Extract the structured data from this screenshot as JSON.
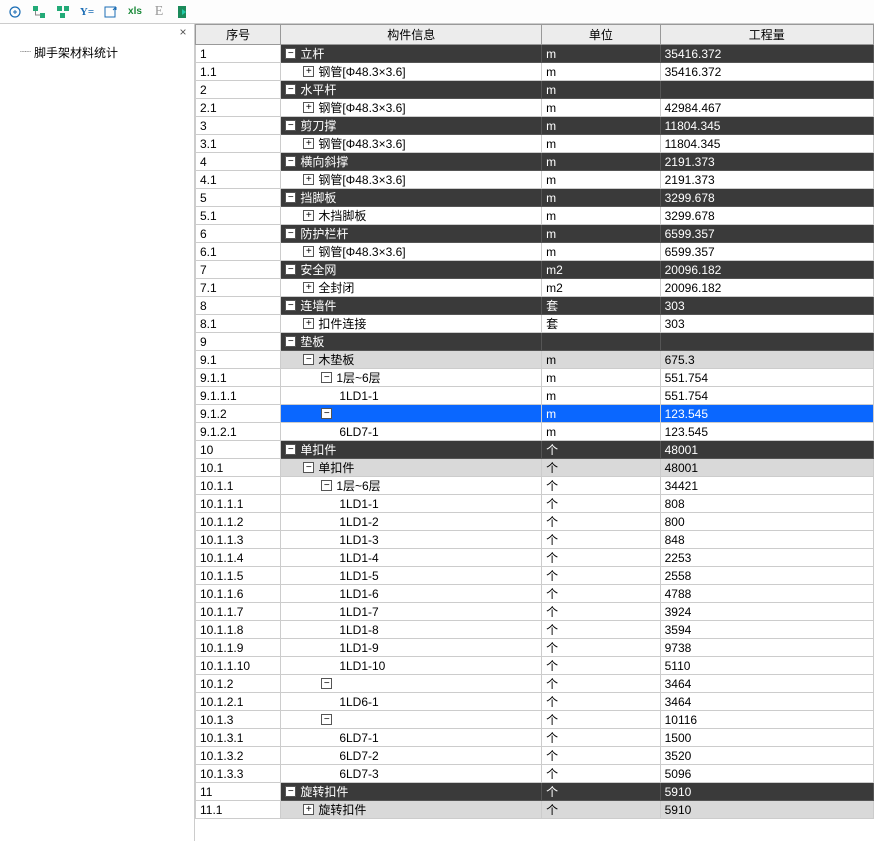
{
  "toolbar": {
    "icons": [
      "link",
      "node1",
      "node2",
      "formula",
      "export",
      "xls",
      "E",
      "exit"
    ]
  },
  "tree": {
    "close": "×",
    "root": "脚手架材料统计"
  },
  "columns": {
    "seq": "序号",
    "info": "构件信息",
    "unit": "单位",
    "qty": "工程量"
  },
  "rows": [
    {
      "seq": "1",
      "info": "立杆",
      "unit": "m",
      "qty": "35416.372",
      "indent": 0,
      "toggle": "-",
      "style": "dark"
    },
    {
      "seq": "1.1",
      "info": "钢管[Φ48.3×3.6]",
      "unit": "m",
      "qty": "35416.372",
      "indent": 1,
      "toggle": "+",
      "style": ""
    },
    {
      "seq": "2",
      "info": "水平杆",
      "unit": "m",
      "qty": "",
      "indent": 0,
      "toggle": "-",
      "style": "dark"
    },
    {
      "seq": "2.1",
      "info": "钢管[Φ48.3×3.6]",
      "unit": "m",
      "qty": "42984.467",
      "indent": 1,
      "toggle": "+",
      "style": ""
    },
    {
      "seq": "3",
      "info": "剪刀撑",
      "unit": "m",
      "qty": "11804.345",
      "indent": 0,
      "toggle": "-",
      "style": "dark"
    },
    {
      "seq": "3.1",
      "info": "钢管[Φ48.3×3.6]",
      "unit": "m",
      "qty": "11804.345",
      "indent": 1,
      "toggle": "+",
      "style": ""
    },
    {
      "seq": "4",
      "info": "横向斜撑",
      "unit": "m",
      "qty": "2191.373",
      "indent": 0,
      "toggle": "-",
      "style": "dark"
    },
    {
      "seq": "4.1",
      "info": "钢管[Φ48.3×3.6]",
      "unit": "m",
      "qty": "2191.373",
      "indent": 1,
      "toggle": "+",
      "style": ""
    },
    {
      "seq": "5",
      "info": "挡脚板",
      "unit": "m",
      "qty": "3299.678",
      "indent": 0,
      "toggle": "-",
      "style": "dark"
    },
    {
      "seq": "5.1",
      "info": "木挡脚板",
      "unit": "m",
      "qty": "3299.678",
      "indent": 1,
      "toggle": "+",
      "style": ""
    },
    {
      "seq": "6",
      "info": "防护栏杆",
      "unit": "m",
      "qty": "6599.357",
      "indent": 0,
      "toggle": "-",
      "style": "dark"
    },
    {
      "seq": "6.1",
      "info": "钢管[Φ48.3×3.6]",
      "unit": "m",
      "qty": "6599.357",
      "indent": 1,
      "toggle": "+",
      "style": ""
    },
    {
      "seq": "7",
      "info": "安全网",
      "unit": "m2",
      "qty": "20096.182",
      "indent": 0,
      "toggle": "-",
      "style": "dark"
    },
    {
      "seq": "7.1",
      "info": "全封闭",
      "unit": "m2",
      "qty": "20096.182",
      "indent": 1,
      "toggle": "+",
      "style": ""
    },
    {
      "seq": "8",
      "info": "连墙件",
      "unit": "套",
      "qty": "303",
      "indent": 0,
      "toggle": "-",
      "style": "dark"
    },
    {
      "seq": "8.1",
      "info": "扣件连接",
      "unit": "套",
      "qty": "303",
      "indent": 1,
      "toggle": "+",
      "style": ""
    },
    {
      "seq": "9",
      "info": "垫板",
      "unit": "",
      "qty": "",
      "indent": 0,
      "toggle": "-",
      "style": "dark"
    },
    {
      "seq": "9.1",
      "info": "木垫板",
      "unit": "m",
      "qty": "675.3",
      "indent": 1,
      "toggle": "-",
      "style": "gray"
    },
    {
      "seq": "9.1.1",
      "info": "1层~6层",
      "unit": "m",
      "qty": "551.754",
      "indent": 2,
      "toggle": "-",
      "style": ""
    },
    {
      "seq": "9.1.1.1",
      "info": "1LD1-1",
      "unit": "m",
      "qty": "551.754",
      "indent": 3,
      "toggle": "",
      "style": ""
    },
    {
      "seq": "9.1.2",
      "info": "",
      "unit": "m",
      "qty": "123.545",
      "indent": 2,
      "toggle": "-",
      "style": "sel"
    },
    {
      "seq": "9.1.2.1",
      "info": "6LD7-1",
      "unit": "m",
      "qty": "123.545",
      "indent": 3,
      "toggle": "",
      "style": ""
    },
    {
      "seq": "10",
      "info": "单扣件",
      "unit": "个",
      "qty": "48001",
      "indent": 0,
      "toggle": "-",
      "style": "dark"
    },
    {
      "seq": "10.1",
      "info": "单扣件",
      "unit": "个",
      "qty": "48001",
      "indent": 1,
      "toggle": "-",
      "style": "gray"
    },
    {
      "seq": "10.1.1",
      "info": "1层~6层",
      "unit": "个",
      "qty": "34421",
      "indent": 2,
      "toggle": "-",
      "style": ""
    },
    {
      "seq": "10.1.1.1",
      "info": "1LD1-1",
      "unit": "个",
      "qty": "808",
      "indent": 3,
      "toggle": "",
      "style": ""
    },
    {
      "seq": "10.1.1.2",
      "info": "1LD1-2",
      "unit": "个",
      "qty": "800",
      "indent": 3,
      "toggle": "",
      "style": ""
    },
    {
      "seq": "10.1.1.3",
      "info": "1LD1-3",
      "unit": "个",
      "qty": "848",
      "indent": 3,
      "toggle": "",
      "style": ""
    },
    {
      "seq": "10.1.1.4",
      "info": "1LD1-4",
      "unit": "个",
      "qty": "2253",
      "indent": 3,
      "toggle": "",
      "style": ""
    },
    {
      "seq": "10.1.1.5",
      "info": "1LD1-5",
      "unit": "个",
      "qty": "2558",
      "indent": 3,
      "toggle": "",
      "style": ""
    },
    {
      "seq": "10.1.1.6",
      "info": "1LD1-6",
      "unit": "个",
      "qty": "4788",
      "indent": 3,
      "toggle": "",
      "style": ""
    },
    {
      "seq": "10.1.1.7",
      "info": "1LD1-7",
      "unit": "个",
      "qty": "3924",
      "indent": 3,
      "toggle": "",
      "style": ""
    },
    {
      "seq": "10.1.1.8",
      "info": "1LD1-8",
      "unit": "个",
      "qty": "3594",
      "indent": 3,
      "toggle": "",
      "style": ""
    },
    {
      "seq": "10.1.1.9",
      "info": "1LD1-9",
      "unit": "个",
      "qty": "9738",
      "indent": 3,
      "toggle": "",
      "style": ""
    },
    {
      "seq": "10.1.1.10",
      "info": "1LD1-10",
      "unit": "个",
      "qty": "5110",
      "indent": 3,
      "toggle": "",
      "style": ""
    },
    {
      "seq": "10.1.2",
      "info": "",
      "unit": "个",
      "qty": "3464",
      "indent": 2,
      "toggle": "-",
      "style": ""
    },
    {
      "seq": "10.1.2.1",
      "info": "1LD6-1",
      "unit": "个",
      "qty": "3464",
      "indent": 3,
      "toggle": "",
      "style": ""
    },
    {
      "seq": "10.1.3",
      "info": "",
      "unit": "个",
      "qty": "10116",
      "indent": 2,
      "toggle": "-",
      "style": ""
    },
    {
      "seq": "10.1.3.1",
      "info": "6LD7-1",
      "unit": "个",
      "qty": "1500",
      "indent": 3,
      "toggle": "",
      "style": ""
    },
    {
      "seq": "10.1.3.2",
      "info": "6LD7-2",
      "unit": "个",
      "qty": "3520",
      "indent": 3,
      "toggle": "",
      "style": ""
    },
    {
      "seq": "10.1.3.3",
      "info": "6LD7-3",
      "unit": "个",
      "qty": "5096",
      "indent": 3,
      "toggle": "",
      "style": ""
    },
    {
      "seq": "11",
      "info": "旋转扣件",
      "unit": "个",
      "qty": "5910",
      "indent": 0,
      "toggle": "-",
      "style": "dark"
    },
    {
      "seq": "11.1",
      "info": "旋转扣件",
      "unit": "个",
      "qty": "5910",
      "indent": 1,
      "toggle": "+",
      "style": "gray"
    }
  ]
}
